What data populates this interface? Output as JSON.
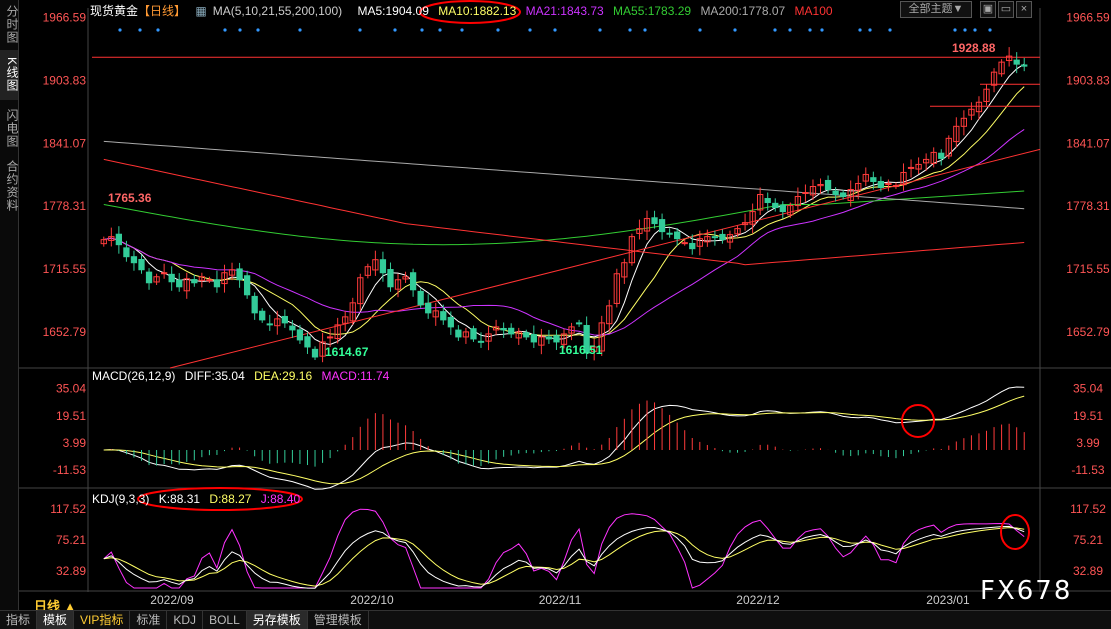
{
  "left_tabs": [
    "分时图",
    "K线图",
    "闪电图",
    "合约资料"
  ],
  "header": {
    "instrument": "现货黄金",
    "period_tag": "【日线】",
    "ma_label": "MA(5,10,21,55,200,100)",
    "ma5": "MA5:1904.09",
    "ma10": "MA10:1882.13",
    "ma21": "MA21:1843.73",
    "ma55": "MA55:1783.29",
    "ma200": "MA200:1778.07",
    "ma100": "MA100",
    "theme_button": "全部主题▼"
  },
  "macd_header": {
    "label": "MACD(26,12,9)",
    "diff": "DIFF:35.04",
    "dea": "DEA:29.16",
    "macd": "MACD:11.74"
  },
  "kdj_header": {
    "label": "KDJ(9,3,3)",
    "k": "K:88.31",
    "d": "D:88.27",
    "j": "J:88.40"
  },
  "period_label": "日线 ▲",
  "bottom_tabs": [
    "指标",
    "模板",
    "VIP指标",
    "标准",
    "KDJ",
    "BOLL",
    "另存模板",
    "管理模板"
  ],
  "watermark": "FX678",
  "colors": {
    "up": "#ff3b3b",
    "down": "#33cc99",
    "ma5": "#ffffff",
    "ma10": "#ffff66",
    "ma21": "#cc33ff",
    "ma55": "#33cc33",
    "ma200": "#aaaaaa",
    "ma100": "#ff3333",
    "annotation": "#ff0000"
  },
  "chart_data": {
    "type": "candlestick",
    "title": "现货黄金",
    "x_labels": [
      "2022/09",
      "2022/10",
      "2022/11",
      "2022/12",
      "2023/01"
    ],
    "price_ticks": [
      "1966.59",
      "1903.83",
      "1841.07",
      "1778.31",
      "1715.55",
      "1652.79"
    ],
    "price_range": [
      1620,
      1970
    ],
    "price_annotations": [
      {
        "label": "1765.36",
        "value": 1765.36
      },
      {
        "label": "1614.67",
        "value": 1614.67
      },
      {
        "label": "1616.51",
        "value": 1616.51
      },
      {
        "label": "1928.88",
        "value": 1928.88
      }
    ],
    "closes": [
      1745,
      1748,
      1740,
      1728,
      1722,
      1715,
      1702,
      1708,
      1712,
      1703,
      1698,
      1706,
      1702,
      1708,
      1705,
      1698,
      1712,
      1715,
      1705,
      1690,
      1672,
      1665,
      1660,
      1666,
      1662,
      1655,
      1645,
      1638,
      1628,
      1643,
      1648,
      1660,
      1668,
      1682,
      1707,
      1718,
      1725,
      1712,
      1698,
      1705,
      1708,
      1695,
      1680,
      1672,
      1674,
      1665,
      1658,
      1648,
      1653,
      1646,
      1643,
      1651,
      1658,
      1655,
      1651,
      1653,
      1648,
      1643,
      1648,
      1646,
      1643,
      1651,
      1658,
      1661,
      1632,
      1638,
      1662,
      1679,
      1711,
      1722,
      1748,
      1756,
      1766,
      1761,
      1753,
      1751,
      1746,
      1742,
      1736,
      1746,
      1748,
      1747,
      1745,
      1750,
      1756,
      1762,
      1773,
      1790,
      1782,
      1777,
      1773,
      1779,
      1788,
      1792,
      1798,
      1800,
      1795,
      1790,
      1788,
      1795,
      1801,
      1810,
      1803,
      1797,
      1801,
      1799,
      1812,
      1817,
      1820,
      1825,
      1832,
      1826,
      1846,
      1858,
      1866,
      1875,
      1882,
      1895,
      1912,
      1922,
      1928,
      1920,
      1918
    ],
    "ma_series": {
      "ma5": "white",
      "ma10": "yellow",
      "ma21": "purple",
      "ma55": "green",
      "ma200": "gray",
      "ma100": "red"
    },
    "macd_ticks": [
      "35.04",
      "19.51",
      "3.99",
      "-11.53"
    ],
    "macd_range": [
      -20,
      40
    ],
    "macd_last": {
      "diff": 35.04,
      "dea": 29.16,
      "macd": 11.74
    },
    "kdj_ticks": [
      "117.52",
      "75.21",
      "32.89"
    ],
    "kdj_range": [
      10,
      130
    ],
    "kdj_last": {
      "k": 88.31,
      "d": 88.27,
      "j": 88.4
    }
  }
}
